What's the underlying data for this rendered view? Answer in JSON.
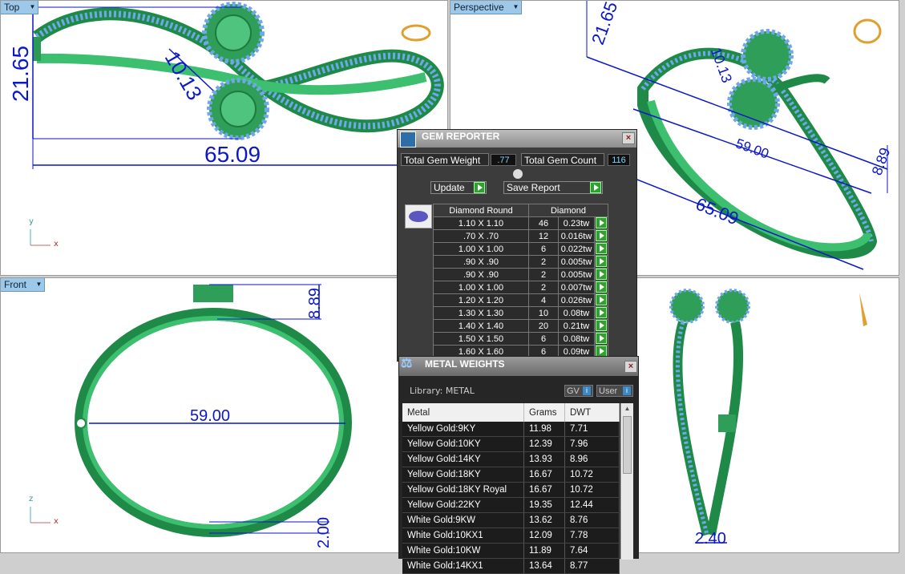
{
  "viewports": {
    "top": {
      "label": "Top",
      "dims": {
        "width": "65.09",
        "height": "21.65",
        "gem": "10.13"
      },
      "axes": {
        "v": "y",
        "h": "x"
      }
    },
    "perspective": {
      "label": "Perspective",
      "dims": {
        "d1": "21.65",
        "d2": "10.13",
        "d3": "59.00",
        "d4": "8.89",
        "d5": "65.09"
      }
    },
    "front": {
      "label": "Front",
      "dims": {
        "width": "59.00",
        "height": "8.89",
        "band": "2.00"
      },
      "axes": {
        "v": "z",
        "h": "x"
      }
    },
    "right": {
      "dims": {
        "width": "2.40"
      }
    }
  },
  "gem_reporter": {
    "title": "GEM REPORTER",
    "total_weight_label": "Total Gem Weight",
    "total_weight_value": ".77",
    "total_count_label": "Total Gem Count",
    "total_count_value": "116",
    "update_label": "Update",
    "save_report_label": "Save Report",
    "col_shape": "Diamond Round",
    "col_material": "Diamond",
    "rows": [
      {
        "size": "1.10 X 1.10",
        "count": "46",
        "tw": "0.23tw"
      },
      {
        "size": ".70 X .70",
        "count": "12",
        "tw": "0.016tw"
      },
      {
        "size": "1.00 X 1.00",
        "count": "6",
        "tw": "0.022tw"
      },
      {
        "size": ".90 X .90",
        "count": "2",
        "tw": "0.005tw"
      },
      {
        "size": ".90 X .90",
        "count": "2",
        "tw": "0.005tw"
      },
      {
        "size": "1.00 X 1.00",
        "count": "2",
        "tw": "0.007tw"
      },
      {
        "size": "1.20 X 1.20",
        "count": "4",
        "tw": "0.026tw"
      },
      {
        "size": "1.30 X 1.30",
        "count": "10",
        "tw": "0.08tw"
      },
      {
        "size": "1.40 X 1.40",
        "count": "20",
        "tw": "0.21tw"
      },
      {
        "size": "1.50 X 1.50",
        "count": "6",
        "tw": "0.08tw"
      },
      {
        "size": "1.60 X 1.60",
        "count": "6",
        "tw": "0.09tw"
      }
    ]
  },
  "metal_weights": {
    "title": "METAL WEIGHTS",
    "library": "Library: METAL",
    "gv_label": "GV",
    "user_label": "User",
    "col_metal": "Metal",
    "col_grams": "Grams",
    "col_dwt": "DWT",
    "rows": [
      {
        "metal": "Yellow Gold:9KY",
        "grams": "11.98",
        "dwt": "7.71"
      },
      {
        "metal": "Yellow Gold:10KY",
        "grams": "12.39",
        "dwt": "7.96"
      },
      {
        "metal": "Yellow Gold:14KY",
        "grams": "13.93",
        "dwt": "8.96"
      },
      {
        "metal": "Yellow Gold:18KY",
        "grams": "16.67",
        "dwt": "10.72"
      },
      {
        "metal": "Yellow Gold:18KY Royal",
        "grams": "16.67",
        "dwt": "10.72"
      },
      {
        "metal": "Yellow Gold:22KY",
        "grams": "19.35",
        "dwt": "12.44"
      },
      {
        "metal": "White Gold:9KW",
        "grams": "13.62",
        "dwt": "8.76"
      },
      {
        "metal": "White Gold:10KX1",
        "grams": "12.09",
        "dwt": "7.78"
      },
      {
        "metal": "White Gold:10KW",
        "grams": "11.89",
        "dwt": "7.64"
      },
      {
        "metal": "White Gold:14KX1",
        "grams": "13.64",
        "dwt": "8.77"
      }
    ]
  },
  "colors": {
    "dimension": "#0b17c8",
    "model": "#2fb860",
    "pave": "#6fa8e8"
  }
}
